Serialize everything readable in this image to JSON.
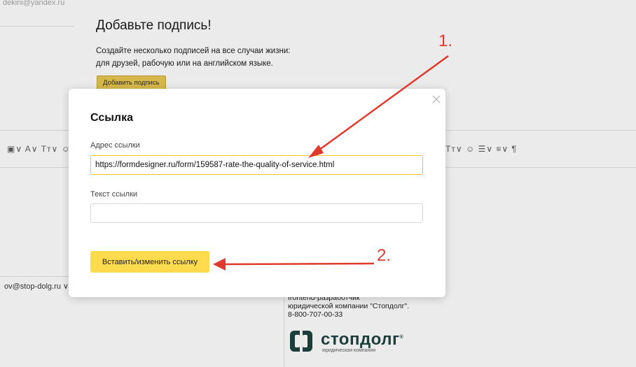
{
  "background": {
    "account_email": "dekini@yandex.ru",
    "promo_title": "Добавьте подпись!",
    "promo_desc_line1": "Создайте несколько подписей на все случаи жизни:",
    "promo_desc_line2": "для друзей, рабочую или на английском языке.",
    "add_signature_label": "Добавить подпись",
    "toolbar_left": "▣∨ A∨ Tт∨ ☺",
    "toolbar_right": "Tт∨ ☺ ☰∨ ≡∨ ¶",
    "from_email": "ov@stop-dolg.ru ∨",
    "signature_line1": "frontend-разработчик",
    "signature_line2": "юридической компании \"Стопдолг\".",
    "signature_line3": "8-800-707-00-33",
    "logo_name": "стопдолг",
    "logo_reg": "®",
    "logo_sub": "юридическая компания"
  },
  "modal": {
    "title": "Ссылка",
    "url_label": "Адрес ссылки",
    "url_value": "https://formdesigner.ru/form/159587-rate-the-quality-of-service.html",
    "text_label": "Текст ссылки",
    "text_value": "",
    "submit_label": "Вставить/изменить ссылку",
    "close_icon": "close-icon"
  },
  "annotations": {
    "label_1": "1.",
    "label_2": "2.",
    "color": "#e03a2c"
  }
}
